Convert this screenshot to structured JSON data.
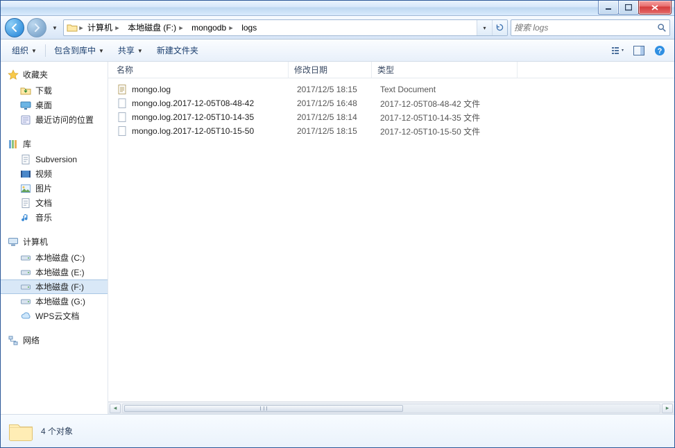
{
  "breadcrumb": {
    "segments": [
      "计算机",
      "本地磁盘 (F:)",
      "mongodb",
      "logs"
    ]
  },
  "search": {
    "placeholder": "搜索 logs"
  },
  "toolbar": {
    "organize": "组织",
    "include": "包含到库中",
    "share": "共享",
    "new_folder": "新建文件夹"
  },
  "columns": {
    "name": "名称",
    "date": "修改日期",
    "type": "类型"
  },
  "files": [
    {
      "name": "mongo.log",
      "date": "2017/12/5 18:15",
      "type": "Text Document",
      "icon": "text"
    },
    {
      "name": "mongo.log.2017-12-05T08-48-42",
      "date": "2017/12/5 16:48",
      "type": "2017-12-05T08-48-42 文件",
      "icon": "file"
    },
    {
      "name": "mongo.log.2017-12-05T10-14-35",
      "date": "2017/12/5 18:14",
      "type": "2017-12-05T10-14-35 文件",
      "icon": "file"
    },
    {
      "name": "mongo.log.2017-12-05T10-15-50",
      "date": "2017/12/5 18:15",
      "type": "2017-12-05T10-15-50 文件",
      "icon": "file"
    }
  ],
  "sidebar": {
    "favorites": {
      "label": "收藏夹",
      "items": [
        "下载",
        "桌面",
        "最近访问的位置"
      ]
    },
    "libraries": {
      "label": "库",
      "items": [
        "Subversion",
        "视频",
        "图片",
        "文档",
        "音乐"
      ]
    },
    "computer": {
      "label": "计算机",
      "items": [
        "本地磁盘 (C:)",
        "本地磁盘 (E:)",
        "本地磁盘 (F:)",
        "本地磁盘 (G:)",
        "WPS云文档"
      ],
      "selected_index": 2
    },
    "network": {
      "label": "网络"
    }
  },
  "status": {
    "text": "4 个对象"
  }
}
